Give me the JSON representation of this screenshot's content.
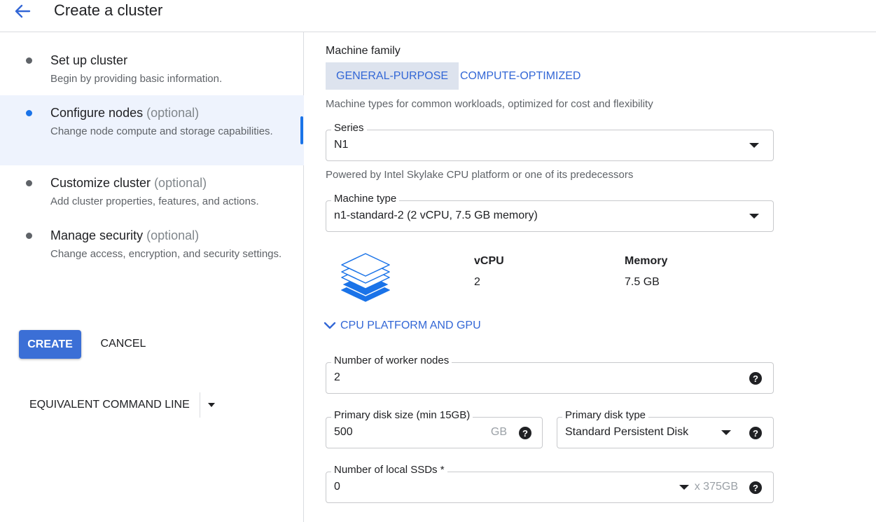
{
  "header": {
    "title": "Create a cluster",
    "back_icon": "arrow-back-icon"
  },
  "steps": [
    {
      "title": "Set up cluster",
      "optional": "",
      "description": "Begin by providing basic information."
    },
    {
      "title": "Configure nodes",
      "optional": "(optional)",
      "description": "Change node compute and storage capabilities."
    },
    {
      "title": "Customize cluster",
      "optional": "(optional)",
      "description": "Add cluster properties, features, and actions."
    },
    {
      "title": "Manage security",
      "optional": "(optional)",
      "description": "Change access, encryption, and security settings."
    }
  ],
  "actions": {
    "create": "CREATE",
    "cancel": "CANCEL",
    "equivalent": "EQUIVALENT COMMAND LINE"
  },
  "machine_family": {
    "label": "Machine family",
    "tabs": [
      "GENERAL-PURPOSE",
      "COMPUTE-OPTIMIZED"
    ],
    "selected": "GENERAL-PURPOSE",
    "helper": "Machine types for common workloads, optimized for cost and flexibility"
  },
  "series": {
    "label": "Series",
    "value": "N1",
    "helper": "Powered by Intel Skylake CPU platform or one of its predecessors"
  },
  "machine_type": {
    "label": "Machine type",
    "value": "n1-standard-2 (2 vCPU, 7.5 GB memory)"
  },
  "specs": {
    "vcpu_label": "vCPU",
    "vcpu_value": "2",
    "memory_label": "Memory",
    "memory_value": "7.5 GB"
  },
  "cpu_platform": {
    "label": "CPU PLATFORM AND GPU"
  },
  "worker_nodes": {
    "label": "Number of worker nodes",
    "value": "2"
  },
  "disk_size": {
    "label": "Primary disk size (min 15GB)",
    "value": "500",
    "unit": "GB"
  },
  "disk_type": {
    "label": "Primary disk type",
    "value": "Standard Persistent Disk"
  },
  "local_ssds": {
    "label": "Number of local SSDs *",
    "value": "0",
    "suffix": "x 375GB"
  },
  "help_glyph": "?",
  "colors": {
    "accent": "#3367d6",
    "primary_button": "#3b6fd6",
    "active_step_bg": "#eef3fd"
  }
}
